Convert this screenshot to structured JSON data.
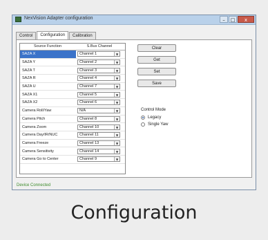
{
  "window": {
    "title": "NexVision Adapter configuration",
    "controls": [
      "–",
      "□",
      "x"
    ]
  },
  "tabs": [
    {
      "label": "Control",
      "active": false
    },
    {
      "label": "Configuration",
      "active": true
    },
    {
      "label": "Calibration",
      "active": false
    }
  ],
  "grid": {
    "columns": [
      "Source Function",
      "S.Bus Channel"
    ],
    "rows": [
      {
        "function": "SAZA X",
        "channel": "Channel 1",
        "selected": true
      },
      {
        "function": "SAZA Y",
        "channel": "Channel 2"
      },
      {
        "function": "SAZA T",
        "channel": "Channel 3"
      },
      {
        "function": "SAZA R",
        "channel": "Channel 4"
      },
      {
        "function": "SAZA U",
        "channel": "Channel 7"
      },
      {
        "function": "SAZA X1",
        "channel": "Channel 5"
      },
      {
        "function": "SAZA X2",
        "channel": "Channel 6"
      },
      {
        "function": "Camera Roll/Yaw",
        "channel": "N/A"
      },
      {
        "function": "Camera Pitch",
        "channel": "Channel 8"
      },
      {
        "function": "Camera Zoom",
        "channel": "Channel 10"
      },
      {
        "function": "Camera Day/IR/NUC",
        "channel": "Channel 11"
      },
      {
        "function": "Camera Freeze",
        "channel": "Channel 13"
      },
      {
        "function": "Camera Sensitivity",
        "channel": "Channel 14"
      },
      {
        "function": "Camera Go to Center",
        "channel": "Channel 9"
      }
    ]
  },
  "buttons": {
    "clear": "Clear",
    "get": "Get",
    "set": "Set",
    "save": "Save"
  },
  "control_mode": {
    "label": "Control Mode",
    "options": [
      {
        "label": "Legacy",
        "checked": true
      },
      {
        "label": "Single Yaw",
        "checked": false
      }
    ]
  },
  "status": "Device Connected",
  "caption": "Configuration"
}
